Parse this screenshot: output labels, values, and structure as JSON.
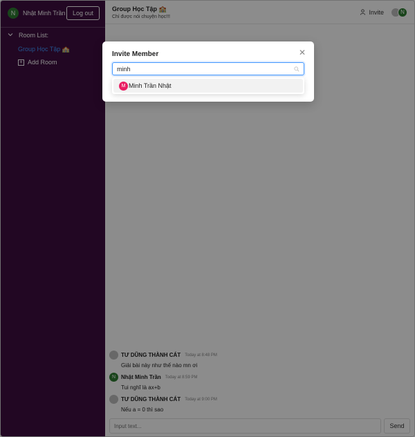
{
  "current_user": {
    "name": "Nhật Minh Trần",
    "avatar_initial": "N"
  },
  "sidebar": {
    "logout_label": "Log out",
    "room_list_label": "Room List:",
    "rooms": [
      {
        "label": "Group Học Tập 🏫"
      }
    ],
    "add_room_label": "Add Room"
  },
  "chat_header": {
    "room_name": "Group Học Tập 🏫",
    "room_description": "Chỉ được nói chuyện học!!!",
    "invite_label": "Invite",
    "member_avatars": [
      {
        "initial": ""
      },
      {
        "initial": "N"
      }
    ]
  },
  "messages": [
    {
      "author": "TƯ DŨNG THÀNH CÁT",
      "time": "Today at 8:48 PM",
      "text": "Giải bài này như thế nào mn ơi",
      "avatar_initial": ""
    },
    {
      "author": "Nhật Minh Trần",
      "time": "Today at 8:59 PM",
      "text": "Tui nghĩ là ax+b",
      "avatar_initial": "N"
    },
    {
      "author": "TƯ DŨNG THÀNH CÁT",
      "time": "Today at 9:00 PM",
      "text": "Nếu a = 0 thì sao",
      "avatar_initial": ""
    }
  ],
  "composer": {
    "placeholder": "Input text...",
    "send_label": "Send"
  },
  "invite_modal": {
    "title": "Invite Member",
    "close_glyph": "✕",
    "search_value": "minh",
    "options": [
      {
        "initial": "M",
        "label": "Minh Trần Nhật"
      }
    ]
  },
  "colors": {
    "sidebar_bg": "#3f0e40",
    "accent": "#4096ff",
    "avatar_green": "#2e7d32",
    "avatar_pink": "#e91e63"
  },
  "icons": {
    "room_list_toggle": "chevron-down-icon",
    "add_room": "plus-square-icon",
    "invite": "user-add-icon",
    "search": "search-icon",
    "close": "close-icon"
  }
}
